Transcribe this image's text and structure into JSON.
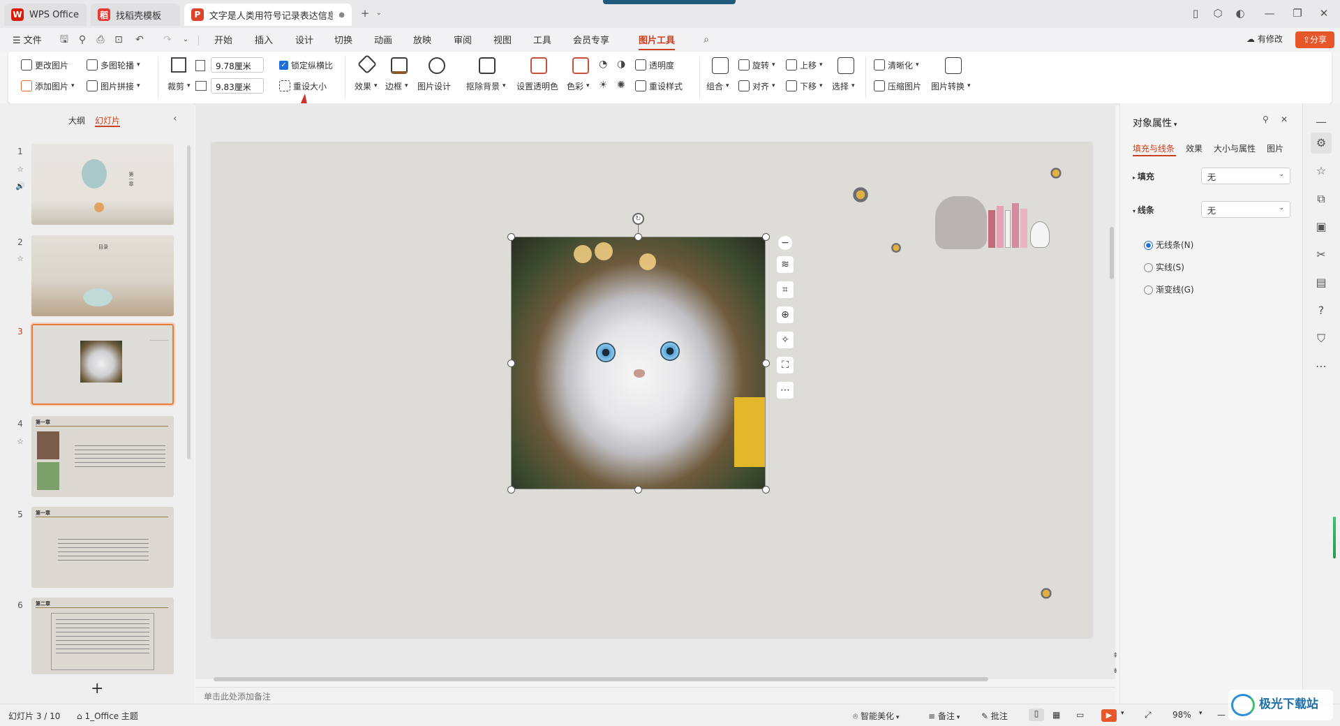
{
  "tabs": [
    {
      "label": "WPS Office",
      "color": "#d81e06",
      "glyph": "W"
    },
    {
      "label": "找稻壳模板",
      "color": "#e53935",
      "glyph": "稻"
    },
    {
      "label": "文字是人类用符号记录表达信息以",
      "color": "#d9442b",
      "glyph": "P"
    }
  ],
  "menu": {
    "file": "文件",
    "items": [
      "开始",
      "插入",
      "设计",
      "切换",
      "动画",
      "放映",
      "审阅",
      "视图",
      "工具",
      "会员专享",
      "图片工具"
    ],
    "active": "图片工具",
    "accent": "#c9411e",
    "has_changes": "有修改",
    "share": "分享"
  },
  "ribbon": {
    "change_picture": "更改图片",
    "multi_carousel": "多图轮播",
    "add_picture": "添加图片",
    "picture_stitch": "图片拼接",
    "crop": "裁剪",
    "width": "9.78厘米",
    "height": "9.83厘米",
    "lock_ratio": "锁定纵横比",
    "reset_size": "重设大小",
    "effects": "效果",
    "border": "边框",
    "picture_design": "图片设计",
    "remove_bg": "抠除背景",
    "set_transparent": "设置透明色",
    "color": "色彩",
    "transparency": "透明度",
    "reset_style": "重设样式",
    "group": "组合",
    "rotate": "旋转",
    "align": "对齐",
    "move_up": "上移",
    "move_down": "下移",
    "select": "选择",
    "sharpen": "清晰化",
    "compress": "压缩图片",
    "convert": "图片转换"
  },
  "left_panel": {
    "outline": "大纲",
    "slides": "幻灯片",
    "thumbs": [
      {
        "num": "1",
        "title": "第一章"
      },
      {
        "num": "2",
        "title": "目录"
      },
      {
        "num": "3",
        "title": ""
      },
      {
        "num": "4",
        "title": "第一章"
      },
      {
        "num": "5",
        "title": "第一章"
      },
      {
        "num": "6",
        "title": "第二章"
      }
    ]
  },
  "editor": {
    "notes_placeholder": "单击此处添加备注"
  },
  "right_panel": {
    "title": "对象属性",
    "tabs": [
      "填充与线条",
      "效果",
      "大小与属性",
      "图片"
    ],
    "fill_label": "填充",
    "fill_value": "无",
    "line_label": "线条",
    "line_value": "无",
    "line_options": [
      "无线条(N)",
      "实线(S)",
      "渐变线(G)"
    ]
  },
  "status": {
    "slide_info": "幻灯片 3 / 10",
    "theme": "1_Office 主题",
    "beautify": "智能美化",
    "notes": "备注",
    "comments": "批注",
    "zoom": "98%"
  },
  "watermark": "极光下载站"
}
